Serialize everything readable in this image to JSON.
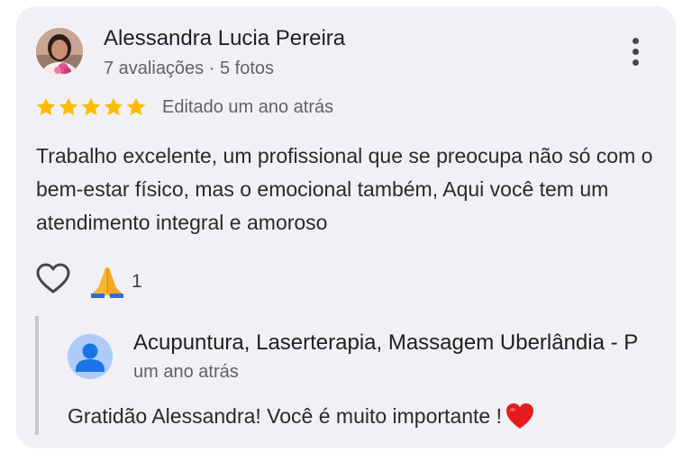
{
  "review": {
    "author_name": "Alessandra Lucia Pereira",
    "author_meta": "7 avaliações · 5 fotos",
    "rating": 5,
    "rating_max": 5,
    "edited_text": "Editado um ano atrás",
    "text": "Trabalho excelente, um profissional que se preocupa não só com o bem-estar físico, mas o emocional também, Aqui você tem um atendimento integral e amoroso",
    "reaction_count": "1",
    "icons": {
      "more": "more-vertical-icon",
      "star": "star-icon",
      "like": "heart-outline-icon",
      "reaction": "folded-hands-emoji"
    }
  },
  "reply": {
    "owner_name": "Acupuntura, Laserterapia, Massagem Uberlândia - P",
    "time": "um ano atrás",
    "text": "Gratidão Alessandra! Você é muito importante !",
    "emoji": "red-heart-emoji"
  },
  "colors": {
    "card_background": "#f1f1f5",
    "star": "#fbbc04",
    "secondary_text": "#5f6368",
    "reply_avatar": "#aecbfa",
    "reply_avatar_figure": "#1a73e8",
    "reply_border": "#c8c8cc"
  }
}
